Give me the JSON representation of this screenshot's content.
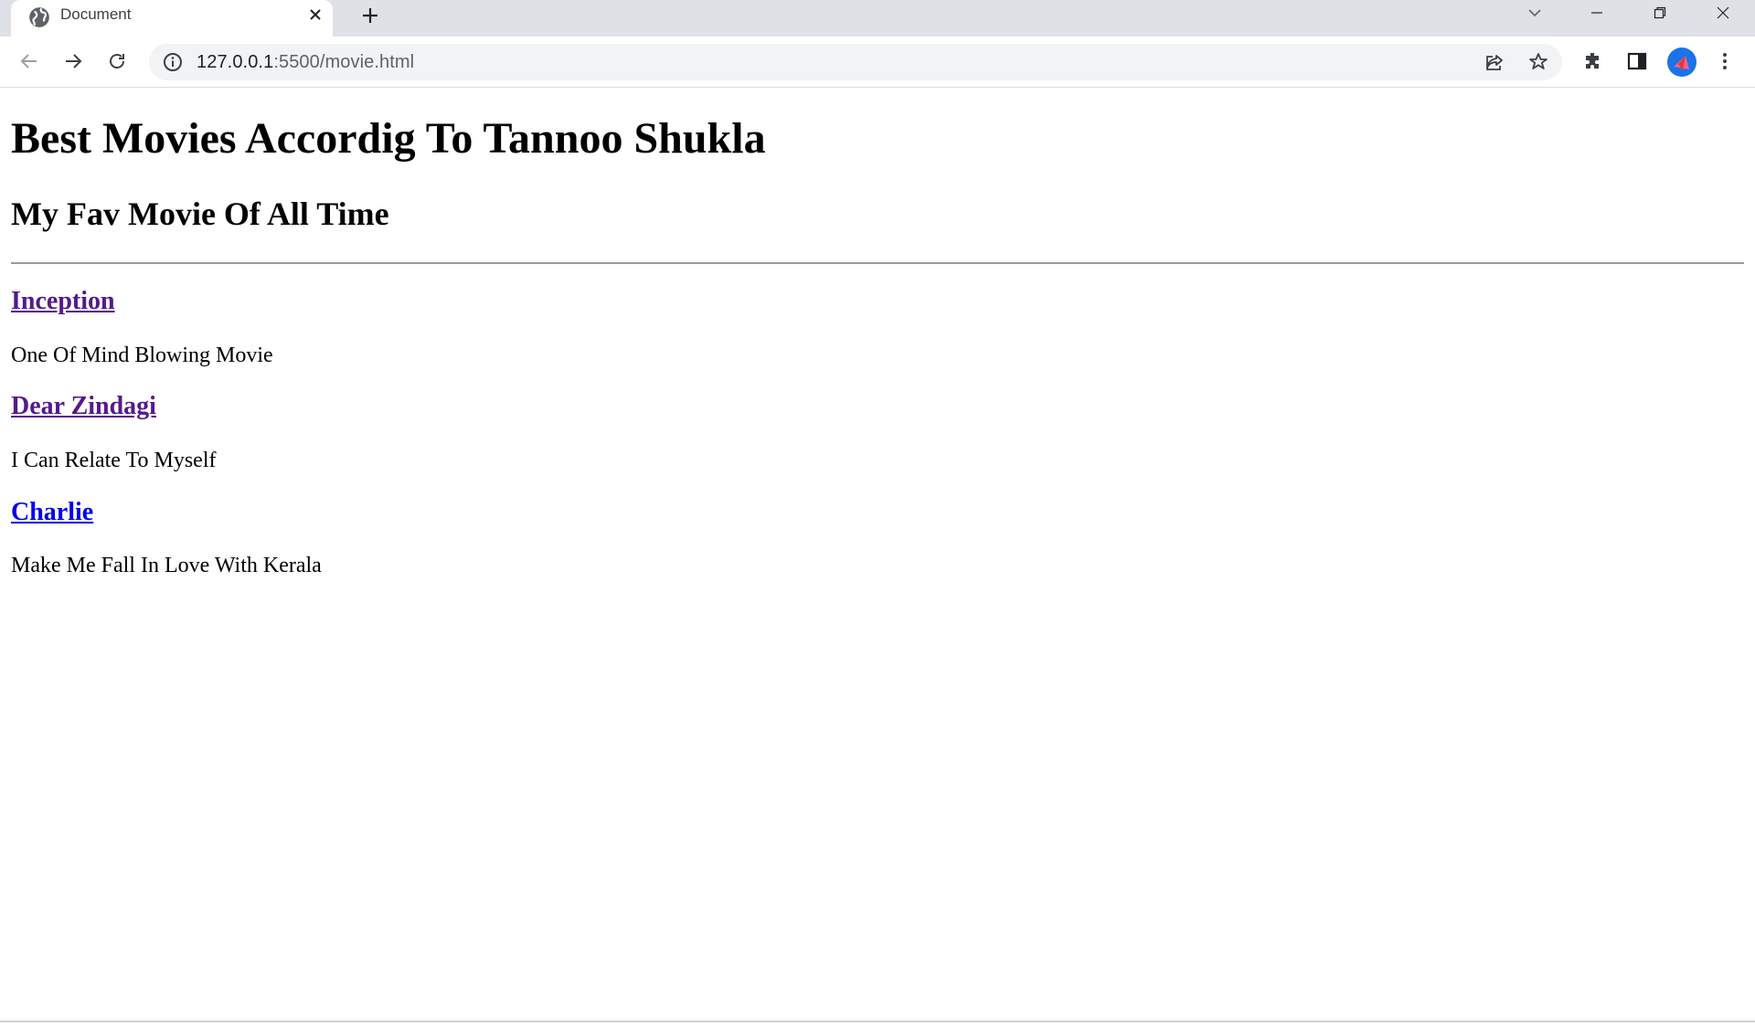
{
  "browser": {
    "tab": {
      "title": "Document"
    },
    "address": {
      "host": "127.0.0.1",
      "path": ":5500/movie.html"
    }
  },
  "page": {
    "title": "Best Movies Accordig To Tannoo Shukla",
    "subtitle": "My Fav Movie Of All Time",
    "movies": [
      {
        "title": "Inception",
        "description": "One Of Mind Blowing Movie",
        "link_color": "#551a8b",
        "visited": true
      },
      {
        "title": "Dear Zindagi",
        "description": "I Can Relate To Myself",
        "link_color": "#551a8b",
        "visited": true
      },
      {
        "title": "Charlie",
        "description": "Make Me Fall In Love With Kerala",
        "link_color": "#0000ee",
        "visited": false
      }
    ]
  },
  "colors": {
    "tabstrip": "#dee1e6",
    "omnibox": "#f1f3f4",
    "avatar": "#1a73e8"
  }
}
